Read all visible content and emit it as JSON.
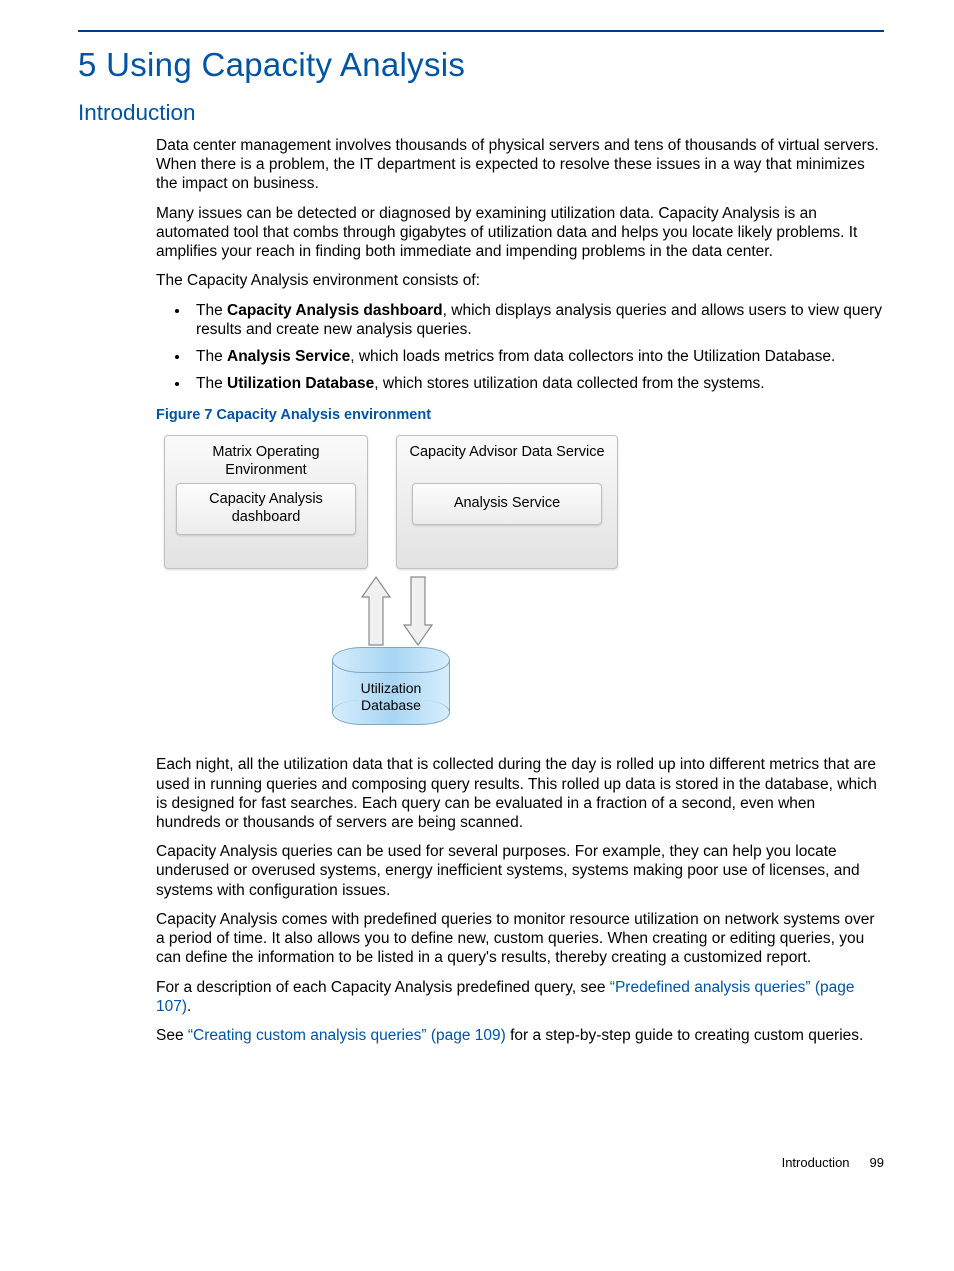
{
  "chapter_title": "5 Using Capacity Analysis",
  "section_title": "Introduction",
  "para1": "Data center management involves thousands of physical servers and tens of thousands of virtual servers. When there is a problem, the IT department is expected to resolve these issues in a way that minimizes the impact on business.",
  "para2": "Many issues can be detected or diagnosed by examining utilization data. Capacity Analysis is an automated tool that combs through gigabytes of utilization data and helps you locate likely problems. It amplifies your reach in finding both immediate and impending problems in the data center.",
  "para3": "The Capacity Analysis environment consists of:",
  "bullets": [
    {
      "pre": "The ",
      "b": "Capacity Analysis dashboard",
      "post": ", which displays analysis queries and allows users to view query results and create new analysis queries."
    },
    {
      "pre": "The ",
      "b": "Analysis Service",
      "post": ", which loads metrics from data collectors into the Utilization Database."
    },
    {
      "pre": "The ",
      "b": "Utilization Database",
      "post": ", which stores utilization data collected from the systems."
    }
  ],
  "figure_caption": "Figure 7 Capacity Analysis environment",
  "diagram": {
    "matrix_env": "Matrix Operating Environment",
    "dashboard": "Capacity Analysis dashboard",
    "advisor": "Capacity Advisor Data Service",
    "analysis_service": "Analysis Service",
    "util_db": "Utilization Database"
  },
  "para4": "Each night, all the utilization data that is collected during the day is rolled up into different metrics that are used in running queries and composing query results. This rolled up data is stored in the database, which is designed for fast searches. Each query can be evaluated in a fraction of a second, even when hundreds or thousands of servers are being scanned.",
  "para5": "Capacity Analysis queries can be used for several purposes. For example, they can help you locate underused or overused systems, energy inefficient systems, systems making poor use of licenses, and systems with configuration issues.",
  "para6": "Capacity Analysis comes with predefined queries to monitor resource utilization on network systems over a period of time. It also allows you to define new, custom queries. When creating or editing queries, you can define the information to be listed in a query's results, thereby creating a customized report.",
  "para7_pre": "For a description of each Capacity Analysis predefined query, see ",
  "link1": "“Predefined analysis queries” (page 107)",
  "para7_post": ".",
  "para8_pre": "See ",
  "link2": "“Creating custom analysis queries” (page 109)",
  "para8_post": " for a step-by-step guide to creating custom queries.",
  "footer_label": "Introduction",
  "footer_pageno": "99"
}
